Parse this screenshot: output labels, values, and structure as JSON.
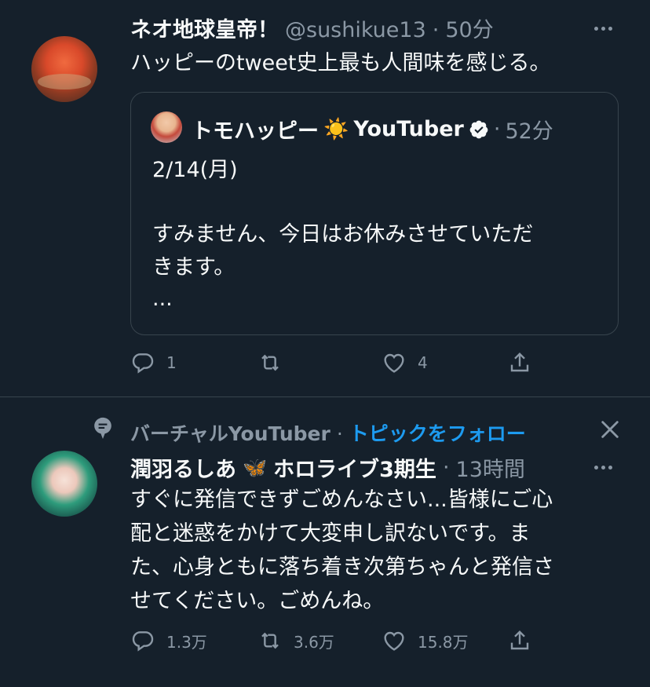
{
  "tweet1": {
    "display_name": "ネオ地球皇帝！",
    "handle": "@sushikue13",
    "separator": "·",
    "time": "50分",
    "text": "ハッピーのtweet史上最も人間味を感じる。",
    "quote": {
      "display_name": "トモハッピー",
      "sun_emoji": "☀️",
      "display_name_suffix": "YouTuber",
      "separator": "·",
      "time": "52分",
      "line1": "2/14(月)",
      "line2": "すみません、今日はお休みさせていただ",
      "line3": "きます。",
      "line4": "..."
    },
    "actions": {
      "reply_count": "1",
      "retweet_count": "",
      "like_count": "4"
    }
  },
  "topic": {
    "label": "バーチャルYouTuber",
    "separator": "·",
    "follow_label": "トピックをフォロー"
  },
  "tweet2": {
    "display_name": "潤羽るしあ",
    "butterfly_emoji": "🦋",
    "display_name_suffix": "ホロライブ3期生",
    "separator": "·",
    "time": "13時間",
    "line1": "すぐに発信できずごめんなさい...皆様にご心",
    "line2": "配と迷惑をかけて大変申し訳ないです。ま",
    "line3": "た、心身ともに落ち着き次第ちゃんと発信さ",
    "line4": "せてください。ごめんね。",
    "actions": {
      "reply_count": "1.3万",
      "retweet_count": "3.6万",
      "like_count": "15.8万"
    }
  },
  "colors": {
    "background": "#15202b",
    "text": "#f7f9f9",
    "muted": "#8b98a5",
    "accent": "#1d9bf0",
    "border": "#38444d"
  },
  "icons": [
    "more-icon",
    "verified-badge-icon",
    "reply-icon",
    "retweet-icon",
    "like-icon",
    "share-icon",
    "topic-icon",
    "close-icon"
  ]
}
